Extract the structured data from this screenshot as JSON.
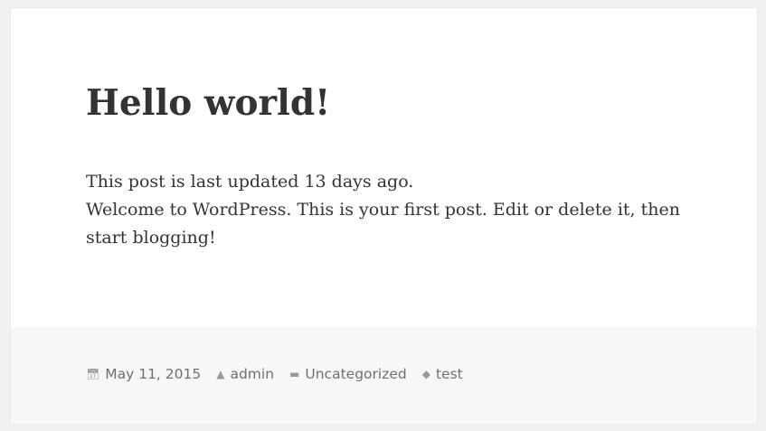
{
  "post": {
    "title": "Hello world!",
    "paragraphs": [
      "This post is last updated 13 days ago.",
      "Welcome to WordPress. This is your first post. Edit or delete it, then start blogging!"
    ]
  },
  "meta": {
    "date": "May 11, 2015",
    "author": "admin",
    "category": "Uncategorized",
    "tag": "test",
    "icons": [
      "calendar-icon",
      "user-icon",
      "folder-icon",
      "tag-icon"
    ]
  }
}
